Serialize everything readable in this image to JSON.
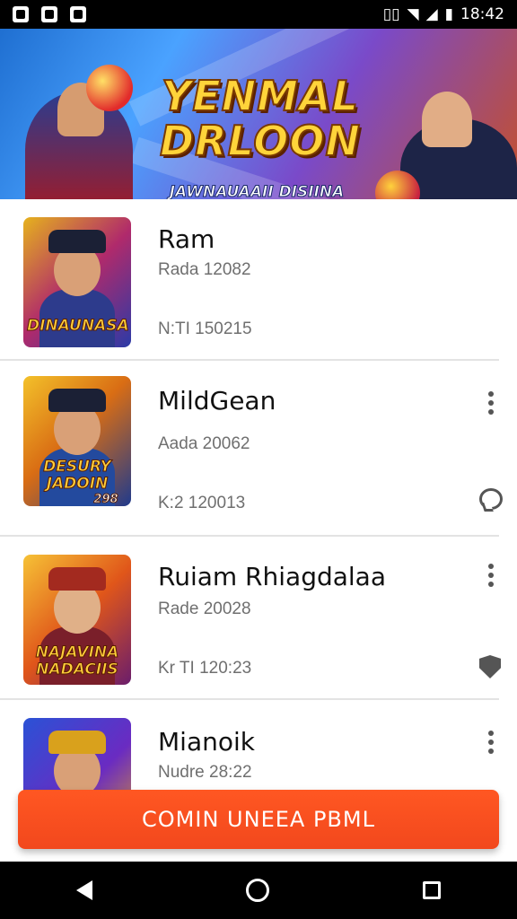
{
  "status_bar": {
    "time": "18:42",
    "left_icons": [
      "image-icon",
      "play-icon",
      "video-icon"
    ],
    "right_icons": [
      "vibrate-icon",
      "wifi-icon",
      "signal-icon",
      "battery-icon"
    ]
  },
  "banner": {
    "title_line1": "YENMAL",
    "title_line2": "DRLOON",
    "subtitle": "JAWNAUAAII DISIINA"
  },
  "list": {
    "items": [
      {
        "title": "Ram",
        "meta1": "Rada 12082",
        "meta2": "N:TI 150215",
        "thumb_caption": "DINAUNASA",
        "action_icon": ""
      },
      {
        "title": "MildGean",
        "meta1": "Aada 20062",
        "meta2": "K:2 120013",
        "thumb_caption": "DESURY JADOIN",
        "thumb_badge": "298",
        "action_icon": "chat-icon"
      },
      {
        "title": "Ruiam Rhiagdalaa",
        "meta1": "Rade 20028",
        "meta2": "Kr TI 120:23",
        "thumb_caption": "NAJAVINA NADACIIS",
        "action_icon": "shield-icon"
      },
      {
        "title": "Mianoik",
        "meta1": "Nudre 28:22",
        "meta2": "",
        "thumb_caption": "",
        "action_icon": ""
      }
    ]
  },
  "cta": {
    "label": "COMIN UNEEA PBML"
  },
  "colors": {
    "accent": "#f4511e",
    "text": "#111111",
    "muted": "#6f6f6f"
  }
}
